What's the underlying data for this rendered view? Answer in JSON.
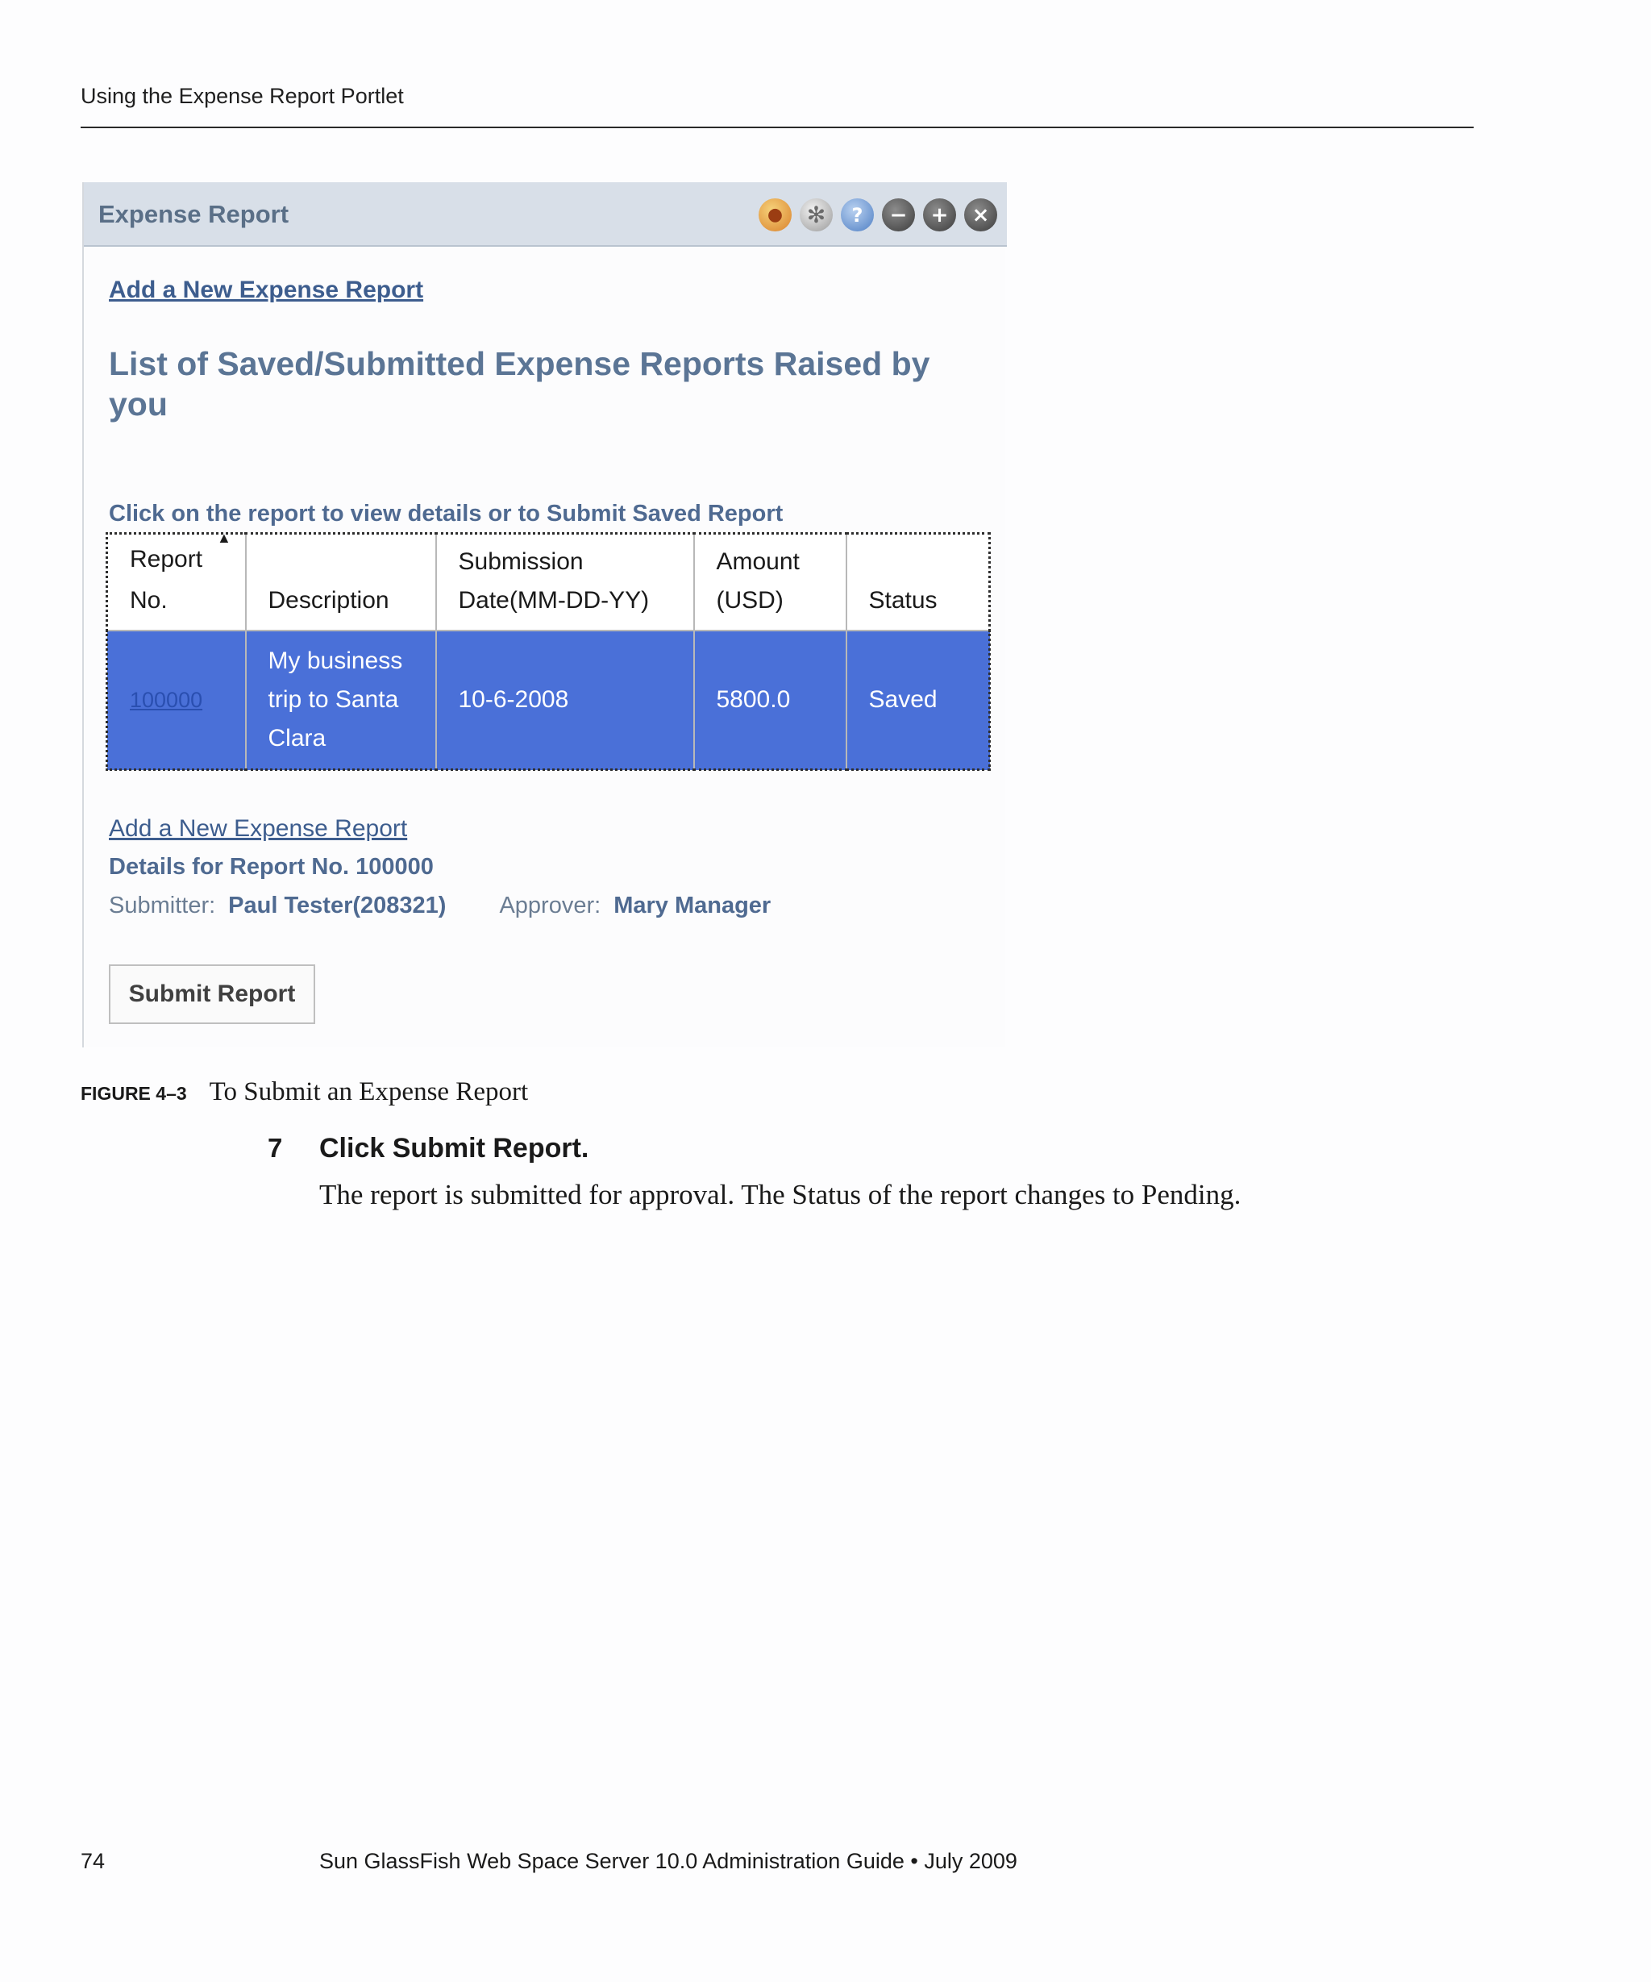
{
  "header": {
    "running_title": "Using the Expense Report Portlet"
  },
  "portlet": {
    "title": "Expense Report",
    "icons": [
      "theme-icon",
      "edit-icon",
      "help-icon",
      "minimize-icon",
      "maximize-icon",
      "close-icon"
    ],
    "add_link_top": "Add a New Expense Report",
    "list_heading": "List of Saved/Submitted Expense Reports Raised by you",
    "instruction": "Click on the report to view details or to Submit Saved Report",
    "table": {
      "headers": {
        "report_no_line1": "Report",
        "report_no_line2": "No.",
        "description": "Description",
        "submission_line1": "Submission",
        "submission_line2": "Date(MM-DD-YY)",
        "amount_line1": "Amount",
        "amount_line2": "(USD)",
        "status": "Status"
      },
      "row": {
        "report_no": "100000",
        "description": "My business trip to Santa Clara",
        "submission_date": "10-6-2008",
        "amount": "5800.0",
        "status": "Saved"
      },
      "selected_row_color": "#4a70d8"
    },
    "add_link_bottom": "Add a New Expense Report",
    "details_heading": "Details for Report No. 100000",
    "submitter_label": "Submitter:",
    "submitter_value": "Paul Tester(208321)",
    "approver_label": "Approver:",
    "approver_value": "Mary Manager",
    "submit_button": "Submit Report"
  },
  "figure": {
    "label": "FIGURE 4–3",
    "caption": "To Submit an Expense Report"
  },
  "step": {
    "number": "7",
    "title": "Click Submit Report.",
    "body": "The report is submitted for approval. The Status of the report changes to Pending."
  },
  "footer": {
    "page_number": "74",
    "book_title": "Sun GlassFish Web Space Server 10.0 Administration Guide • July 2009"
  }
}
